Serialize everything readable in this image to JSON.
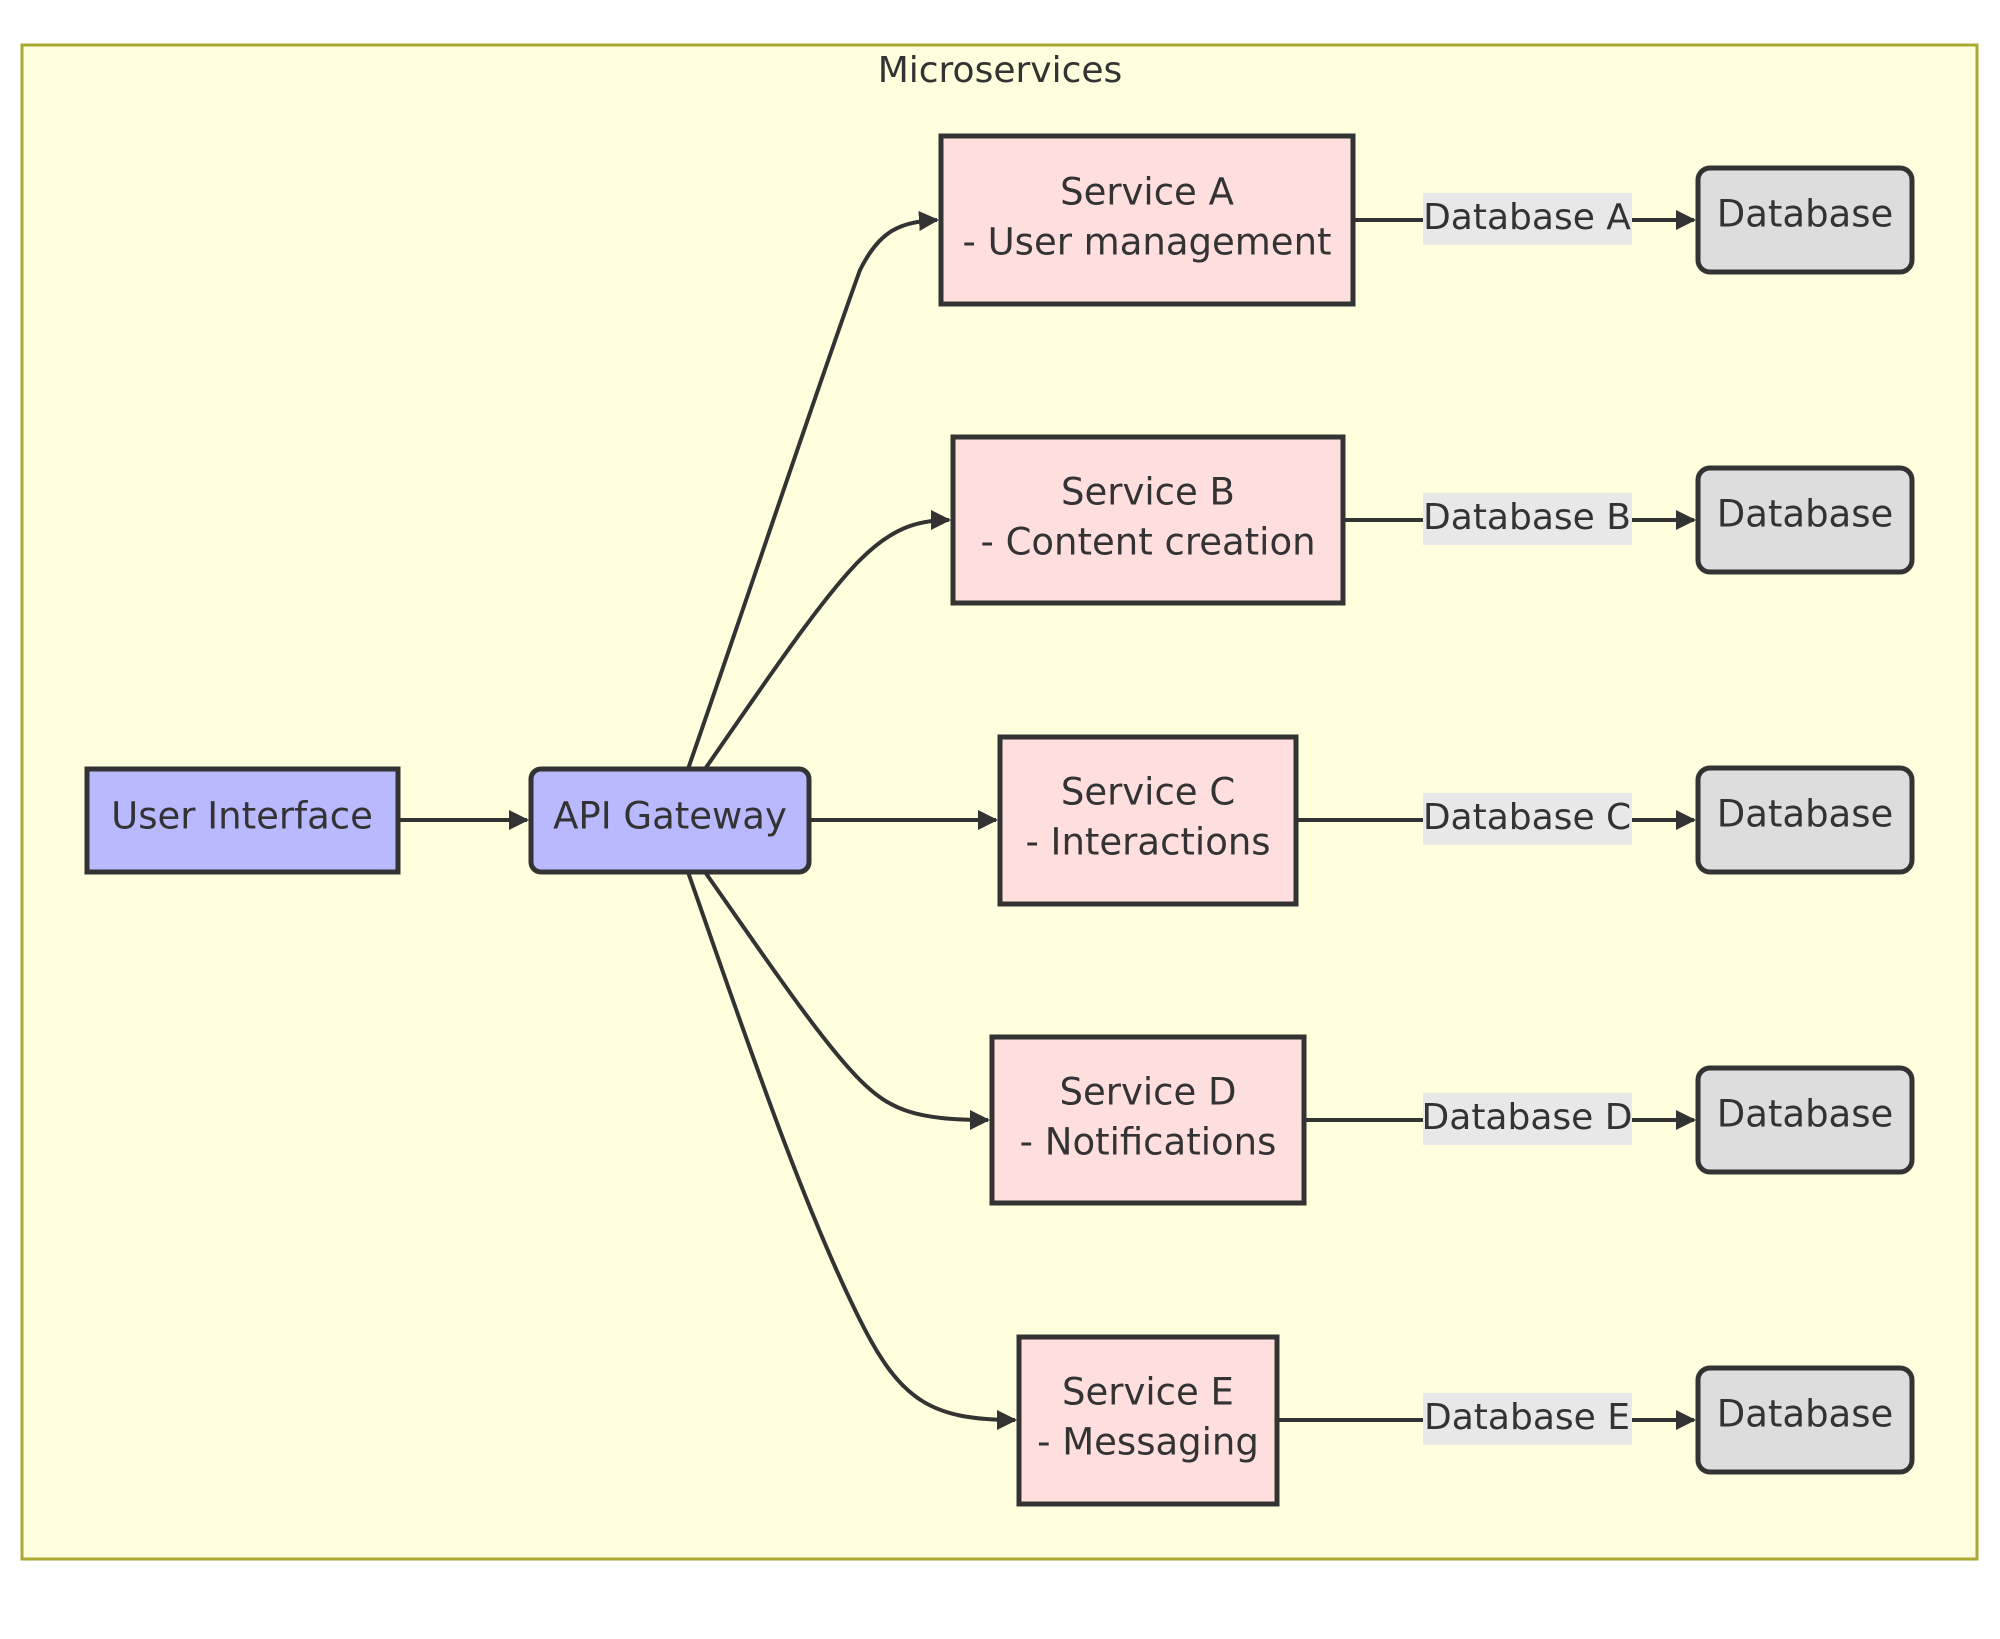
{
  "cluster": {
    "title": "Microservices"
  },
  "nodes": {
    "user_interface": {
      "label": "User Interface"
    },
    "api_gateway": {
      "label": "API Gateway"
    },
    "services": [
      {
        "title": "Service A",
        "desc": "- User management"
      },
      {
        "title": "Service B",
        "desc": "- Content creation"
      },
      {
        "title": "Service C",
        "desc": "- Interactions"
      },
      {
        "title": "Service D",
        "desc": "- Notifications"
      },
      {
        "title": "Service E",
        "desc": "- Messaging"
      }
    ],
    "databases": [
      {
        "label": "Database"
      },
      {
        "label": "Database"
      },
      {
        "label": "Database"
      },
      {
        "label": "Database"
      },
      {
        "label": "Database"
      }
    ]
  },
  "edges": {
    "db_labels": [
      "Database A",
      "Database B",
      "Database C",
      "Database D",
      "Database E"
    ]
  },
  "colors": {
    "cluster_fill": "#ffffde",
    "cluster_border": "#aaaa33",
    "ui_fill": "#b9b9ff",
    "service_fill": "#ffdede",
    "database_fill": "#dddddd",
    "stroke": "#333333",
    "edge_label_bg": "#e8e8e8"
  }
}
